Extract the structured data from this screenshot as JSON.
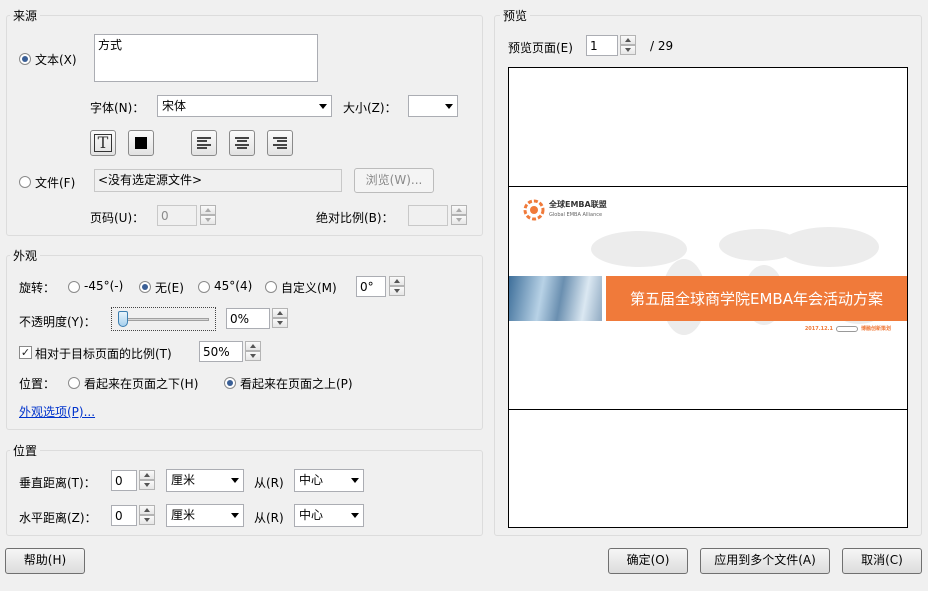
{
  "source": {
    "title": "来源",
    "text_option": "文本(X)",
    "text_value": "方式",
    "font_label": "字体(N)：",
    "font_value": "宋体",
    "size_label": "大小(Z)：",
    "size_value": "",
    "file_option": "文件(F)",
    "file_value": "<没有选定源文件>",
    "browse_button": "浏览(W)...",
    "page_label": "页码(U)：",
    "page_value": "0",
    "scale_label": "绝对比例(B)：",
    "scale_value": ""
  },
  "appearance": {
    "title": "外观",
    "rotate_label": "旋转：",
    "rotate_options": [
      "-45°(-)",
      "无(E)",
      "45°(4)",
      "自定义(M)"
    ],
    "rotate_custom_value": "0°",
    "opacity_label": "不透明度(Y)：",
    "opacity_fraction": 0.0,
    "opacity_value": "0%",
    "relative_label": "相对于目标页面的比例(T)",
    "relative_value": "50%",
    "position_label": "位置：",
    "position_options": [
      "看起来在页面之下(H)",
      "看起来在页面之上(P)"
    ],
    "options_link": "外观选项(P)..."
  },
  "position": {
    "title": "位置",
    "vertical_label": "垂直距离(T)：",
    "vertical_value": "0",
    "vertical_unit": "厘米",
    "vertical_from_label": "从(R)",
    "vertical_from": "中心",
    "horizontal_label": "水平距离(Z)：",
    "horizontal_value": "0",
    "horizontal_unit": "厘米",
    "horizontal_from_label": "从(R)",
    "horizontal_from": "中心"
  },
  "preview": {
    "title": "预览",
    "page_label": "预览页面(E)",
    "page_value": "1",
    "page_total": "/ 29",
    "slide_logo_text": "全球EMBA联盟",
    "slide_logo_sub": "Global EMBA Alliance",
    "slide_title": "第五届全球商学院EMBA年会活动方案",
    "slide_date": "2017.12.1",
    "slide_company": "博融创新策划",
    "accent_color": "#f07a3a"
  },
  "footer": {
    "help_button": "帮助(H)",
    "ok_button": "确定(O)",
    "apply_button": "应用到多个文件(A)",
    "cancel_button": "取消(C)"
  }
}
